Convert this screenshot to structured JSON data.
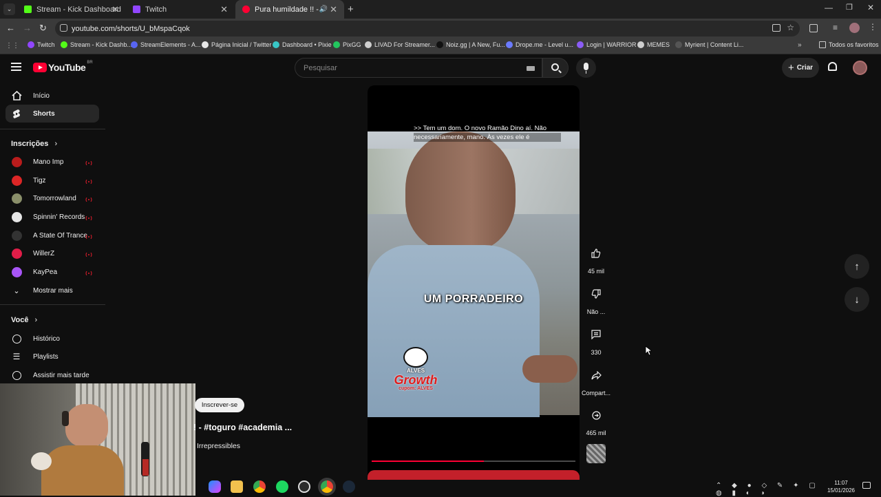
{
  "browser": {
    "tabs": [
      {
        "title": "Stream - Kick Dashboard",
        "close": "✕"
      },
      {
        "title": "Twitch",
        "close": "✕"
      },
      {
        "title": "Pura humildade !! - #togur",
        "close": "✕"
      }
    ],
    "new_tab": "+",
    "address": "youtube.com/shorts/U_bMspaCqok",
    "bookmarks": [
      {
        "label": "Twitch",
        "color": "#9146ff"
      },
      {
        "label": "Stream - Kick Dashb...",
        "color": "#53fc18"
      },
      {
        "label": "StreamElements - A...",
        "color": "#5865f2"
      },
      {
        "label": "Página Inicial / Twitter",
        "color": "#e7e7e7"
      },
      {
        "label": "Dashboard • Pixie",
        "color": "#38c7c7"
      },
      {
        "label": "PixGG",
        "color": "#22c55e"
      },
      {
        "label": "LIVAD For Streamer...",
        "color": "#cfcfcf"
      },
      {
        "label": "Noiz.gg | A New, Fu...",
        "color": "#111111"
      },
      {
        "label": "Drope.me - Level u...",
        "color": "#6b7bff"
      },
      {
        "label": "Login | WARRIOR",
        "color": "#8b5cf6"
      },
      {
        "label": "MEMES",
        "color": "#cfcfcf"
      },
      {
        "label": "Myrient | Content Li...",
        "color": "#555555"
      }
    ],
    "all_bookmarks": "Todos os favoritos"
  },
  "youtube": {
    "logo": "YouTube",
    "region": "BR",
    "search_placeholder": "Pesquisar",
    "create_label": "Criar",
    "sidebar": {
      "main": [
        {
          "label": "Início",
          "icon": "home-icon"
        },
        {
          "label": "Shorts",
          "icon": "shorts-icon"
        }
      ],
      "subscriptions_title": "Inscrições",
      "subscriptions": [
        {
          "label": "Mano Imp",
          "color": "#b91c1c"
        },
        {
          "label": "Tigz",
          "color": "#dc2626"
        },
        {
          "label": "Tomorrowland",
          "color": "#8a8f6a"
        },
        {
          "label": "Spinnin' Records",
          "color": "#e5e5e5"
        },
        {
          "label": "A State Of Trance",
          "color": "#333333"
        },
        {
          "label": "WillerZ",
          "color": "#e11d48"
        },
        {
          "label": "KayPea",
          "color": "#a855f7"
        }
      ],
      "show_more": "Mostrar mais",
      "you_title": "Você",
      "you_items": [
        {
          "label": "Histórico",
          "icon": "history-icon"
        },
        {
          "label": "Playlists",
          "icon": "playlists-icon"
        },
        {
          "label": "Assistir mais tarde",
          "icon": "watch-later-icon"
        }
      ]
    },
    "short": {
      "caption_line1": ">> Tem um dom. O novo Ramão Dino aí. Não",
      "caption_line2": "necessariamente, mano. Às vezes ele é",
      "overlay_text": "UM PORRADEIRO",
      "sponsor_top": "ALVES",
      "sponsor_main": "Growth",
      "sponsor_sub": "cupom: ALVES",
      "title": "! - #toguro #academia ...",
      "channel": "Irrepressibles",
      "subscribe": "Inscrever-se",
      "progress": 0.55
    },
    "actions": [
      {
        "label": "45 mil",
        "icon": "like-icon"
      },
      {
        "label": "Não ...",
        "icon": "dislike-icon"
      },
      {
        "label": "330",
        "icon": "comments-icon"
      },
      {
        "label": "Compart...",
        "icon": "share-icon"
      },
      {
        "label": "465 mil",
        "icon": "remix-icon"
      }
    ]
  },
  "taskbar": {
    "time": "11:07",
    "date": "15/01/2026"
  }
}
